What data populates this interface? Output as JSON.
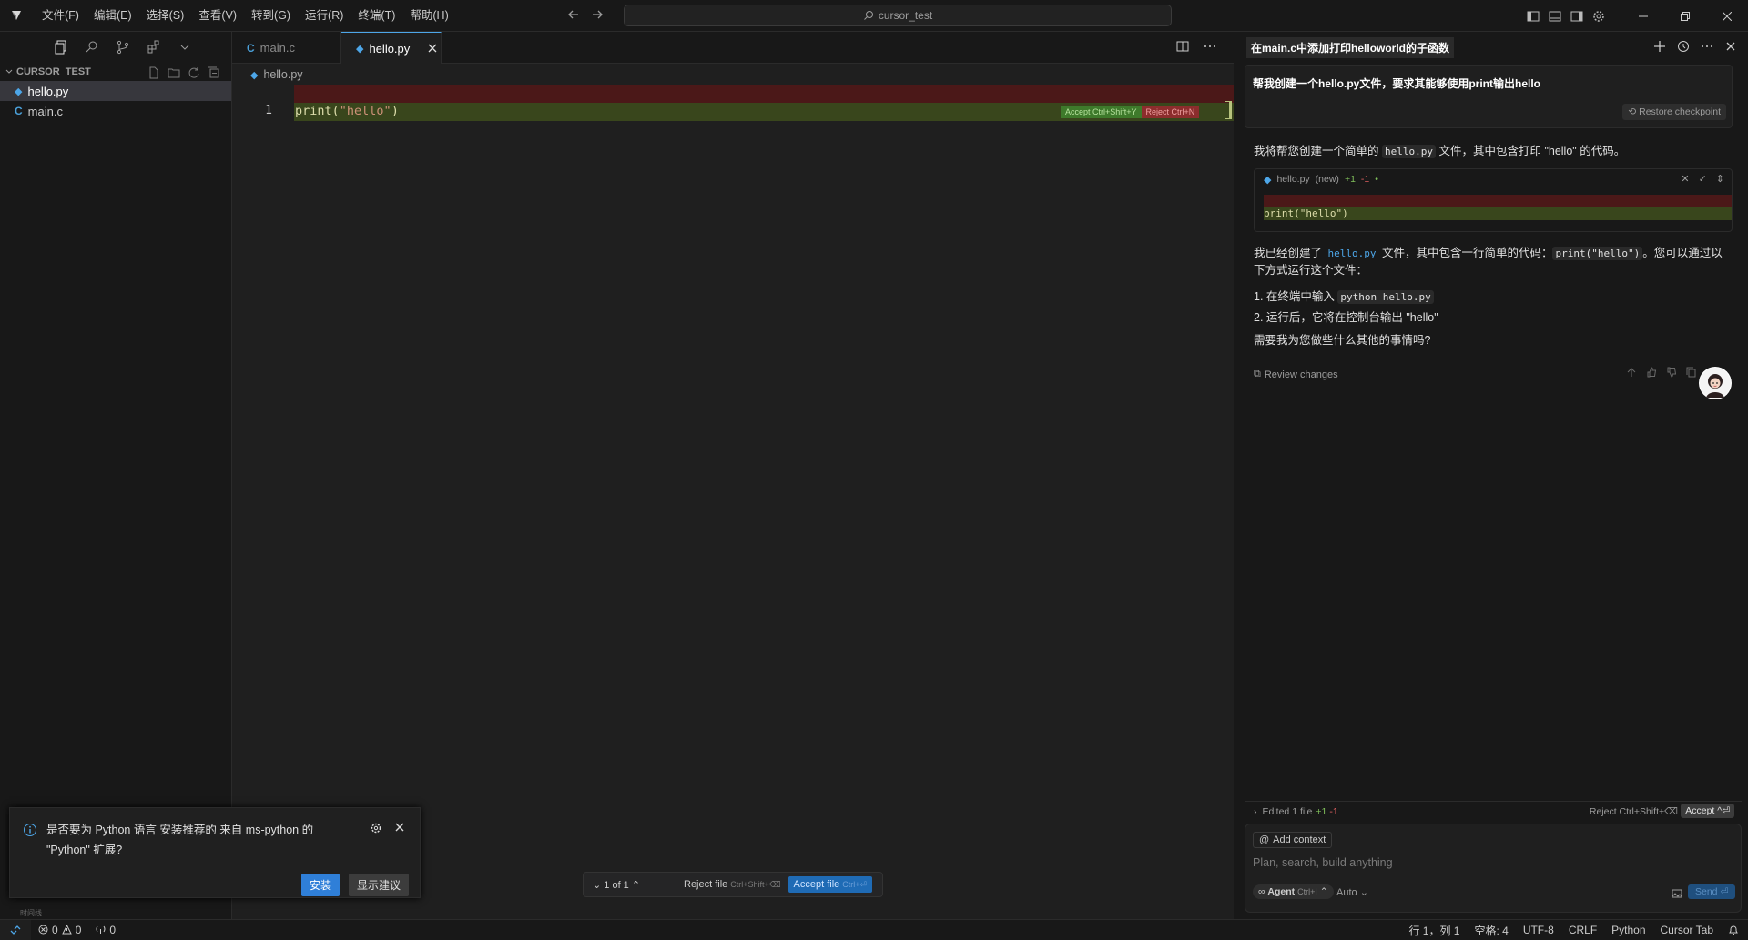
{
  "menu": [
    "文件(F)",
    "编辑(E)",
    "选择(S)",
    "查看(V)",
    "转到(G)",
    "运行(R)",
    "终端(T)",
    "帮助(H)"
  ],
  "search": {
    "text": "cursor_test"
  },
  "sidebar": {
    "header": "CURSOR_TEST",
    "files": [
      {
        "name": "hello.py",
        "icon": "python-icon",
        "active": true
      },
      {
        "name": "main.c",
        "icon": "c-icon",
        "active": false
      }
    ],
    "outline_label": "时间线"
  },
  "editor": {
    "tabs": [
      {
        "label": "main.c",
        "icon": "C"
      },
      {
        "label": "hello.py",
        "icon": "python"
      }
    ],
    "breadcrumb": "hello.py",
    "line_number": "1",
    "code_fn": "print(",
    "code_str": "\"hello\"",
    "code_end": ")",
    "inline_accept": "Accept Ctrl+Shift+Y",
    "inline_reject": "Reject Ctrl+N",
    "review_counter": "1 of 1",
    "reject_file": "Reject file",
    "reject_file_kbd": "Ctrl+Shift+⌫",
    "accept_file": "Accept file",
    "accept_file_kbd": "Ctrl+⏎"
  },
  "notification": {
    "text_line1": "是否要为 Python 语言 安装推荐的 来自 ms-python 的",
    "text_line2": "\"Python\" 扩展?",
    "install": "安装",
    "show_suggestions": "显示建议"
  },
  "chat": {
    "title": "在main.c中添加打印helloworld的子函数",
    "user_message": "帮我创建一个hello.py文件，要求其能够使用print输出hello",
    "restore": "Restore checkpoint",
    "reply1_pre": "我将帮您创建一个简单的",
    "reply1_code": "hello.py",
    "reply1_post": "文件，其中包含打印 \"hello\" 的代码。",
    "card_file": "hello.py",
    "card_new": "(new)",
    "card_plus": "+1",
    "card_minus": "-1",
    "card_code": "print(\"hello\")",
    "reply2_pre": "我已经创建了",
    "reply2_code": "hello.py",
    "reply2_mid": "文件，其中包含一行简单的代码：",
    "reply2_code2": "print(\"hello\")",
    "reply2_post": "。您可以通过以",
    "reply2_line2": "下方式运行这个文件：",
    "step1_pre": "1. 在终端中输入",
    "step1_code": "python hello.py",
    "step2": "2. 运行后，它将在控制台输出 \"hello\"",
    "question": "需要我为您做些什么其他的事情吗?",
    "review_changes": "Review changes",
    "edited": "Edited 1 file",
    "edited_plus": "+1",
    "edited_minus": "-1",
    "edited_reject": "Reject Ctrl+Shift+⌫",
    "edited_accept": "Accept ^⏎",
    "add_context": "Add context",
    "placeholder": "Plan, search, build anything",
    "agent": "Agent",
    "agent_kbd": "Ctrl+I",
    "auto": "Auto",
    "send": "Send"
  },
  "status": {
    "errors": "0",
    "warnings": "0",
    "ports": "0",
    "position": "行 1，列 1",
    "spaces": "空格: 4",
    "encoding": "UTF-8",
    "eol": "CRLF",
    "language": "Python",
    "cursor_tab": "Cursor Tab"
  }
}
